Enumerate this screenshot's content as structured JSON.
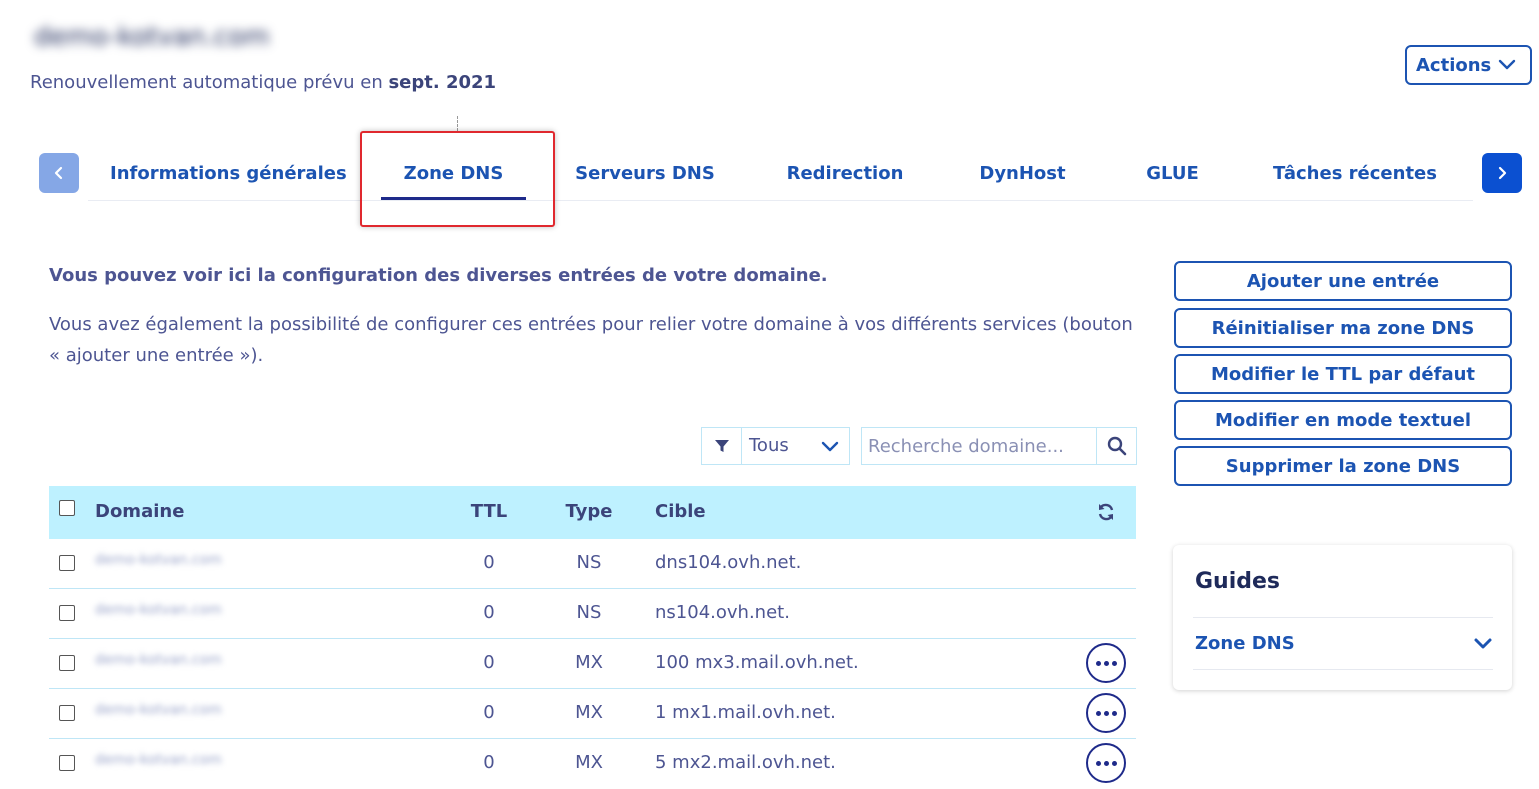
{
  "header": {
    "domain_name": "demo-kotvan.com",
    "renewal_prefix": "Renouvellement automatique prévu en",
    "renewal_date": "sept. 2021",
    "actions_label": "Actions"
  },
  "tabs": [
    {
      "label": "Informations générales",
      "active": false
    },
    {
      "label": "Zone DNS",
      "active": true
    },
    {
      "label": "Serveurs DNS",
      "active": false
    },
    {
      "label": "Redirection",
      "active": false
    },
    {
      "label": "DynHost",
      "active": false
    },
    {
      "label": "GLUE",
      "active": false
    },
    {
      "label": "Tâches récentes",
      "active": false
    }
  ],
  "intro": {
    "title": "Vous pouvez voir ici la configuration des diverses entrées de votre domaine.",
    "text": "Vous avez également la possibilité de configurer ces entrées pour relier votre domaine à vos différents services (bouton « ajouter une entrée »)."
  },
  "side_actions": {
    "add_entry": "Ajouter une entrée",
    "reset_zone": "Réinitialiser ma zone DNS",
    "modify_ttl": "Modifier le TTL par défaut",
    "text_mode": "Modifier en mode textuel",
    "delete_zone": "Supprimer la zone DNS"
  },
  "guides": {
    "title": "Guides",
    "item": "Zone DNS"
  },
  "filter": {
    "selected": "Tous",
    "search_placeholder": "Recherche domaine..."
  },
  "table": {
    "columns": {
      "domain": "Domaine",
      "ttl": "TTL",
      "type": "Type",
      "target": "Cible"
    },
    "rows": [
      {
        "domain": "demo-kotvan.com",
        "ttl": "0",
        "type": "NS",
        "target": "dns104.ovh.net.",
        "has_menu": false
      },
      {
        "domain": "demo-kotvan.com",
        "ttl": "0",
        "type": "NS",
        "target": "ns104.ovh.net.",
        "has_menu": false
      },
      {
        "domain": "demo-kotvan.com",
        "ttl": "0",
        "type": "MX",
        "target": "100 mx3.mail.ovh.net.",
        "has_menu": true
      },
      {
        "domain": "demo-kotvan.com",
        "ttl": "0",
        "type": "MX",
        "target": "1 mx1.mail.ovh.net.",
        "has_menu": true
      },
      {
        "domain": "demo-kotvan.com",
        "ttl": "0",
        "type": "MX",
        "target": "5 mx2.mail.ovh.net.",
        "has_menu": true
      }
    ]
  },
  "colors": {
    "primary": "#1c54b2",
    "text": "#4d5592",
    "table_header_bg": "#bef1ff",
    "highlight": "#e0282e"
  }
}
